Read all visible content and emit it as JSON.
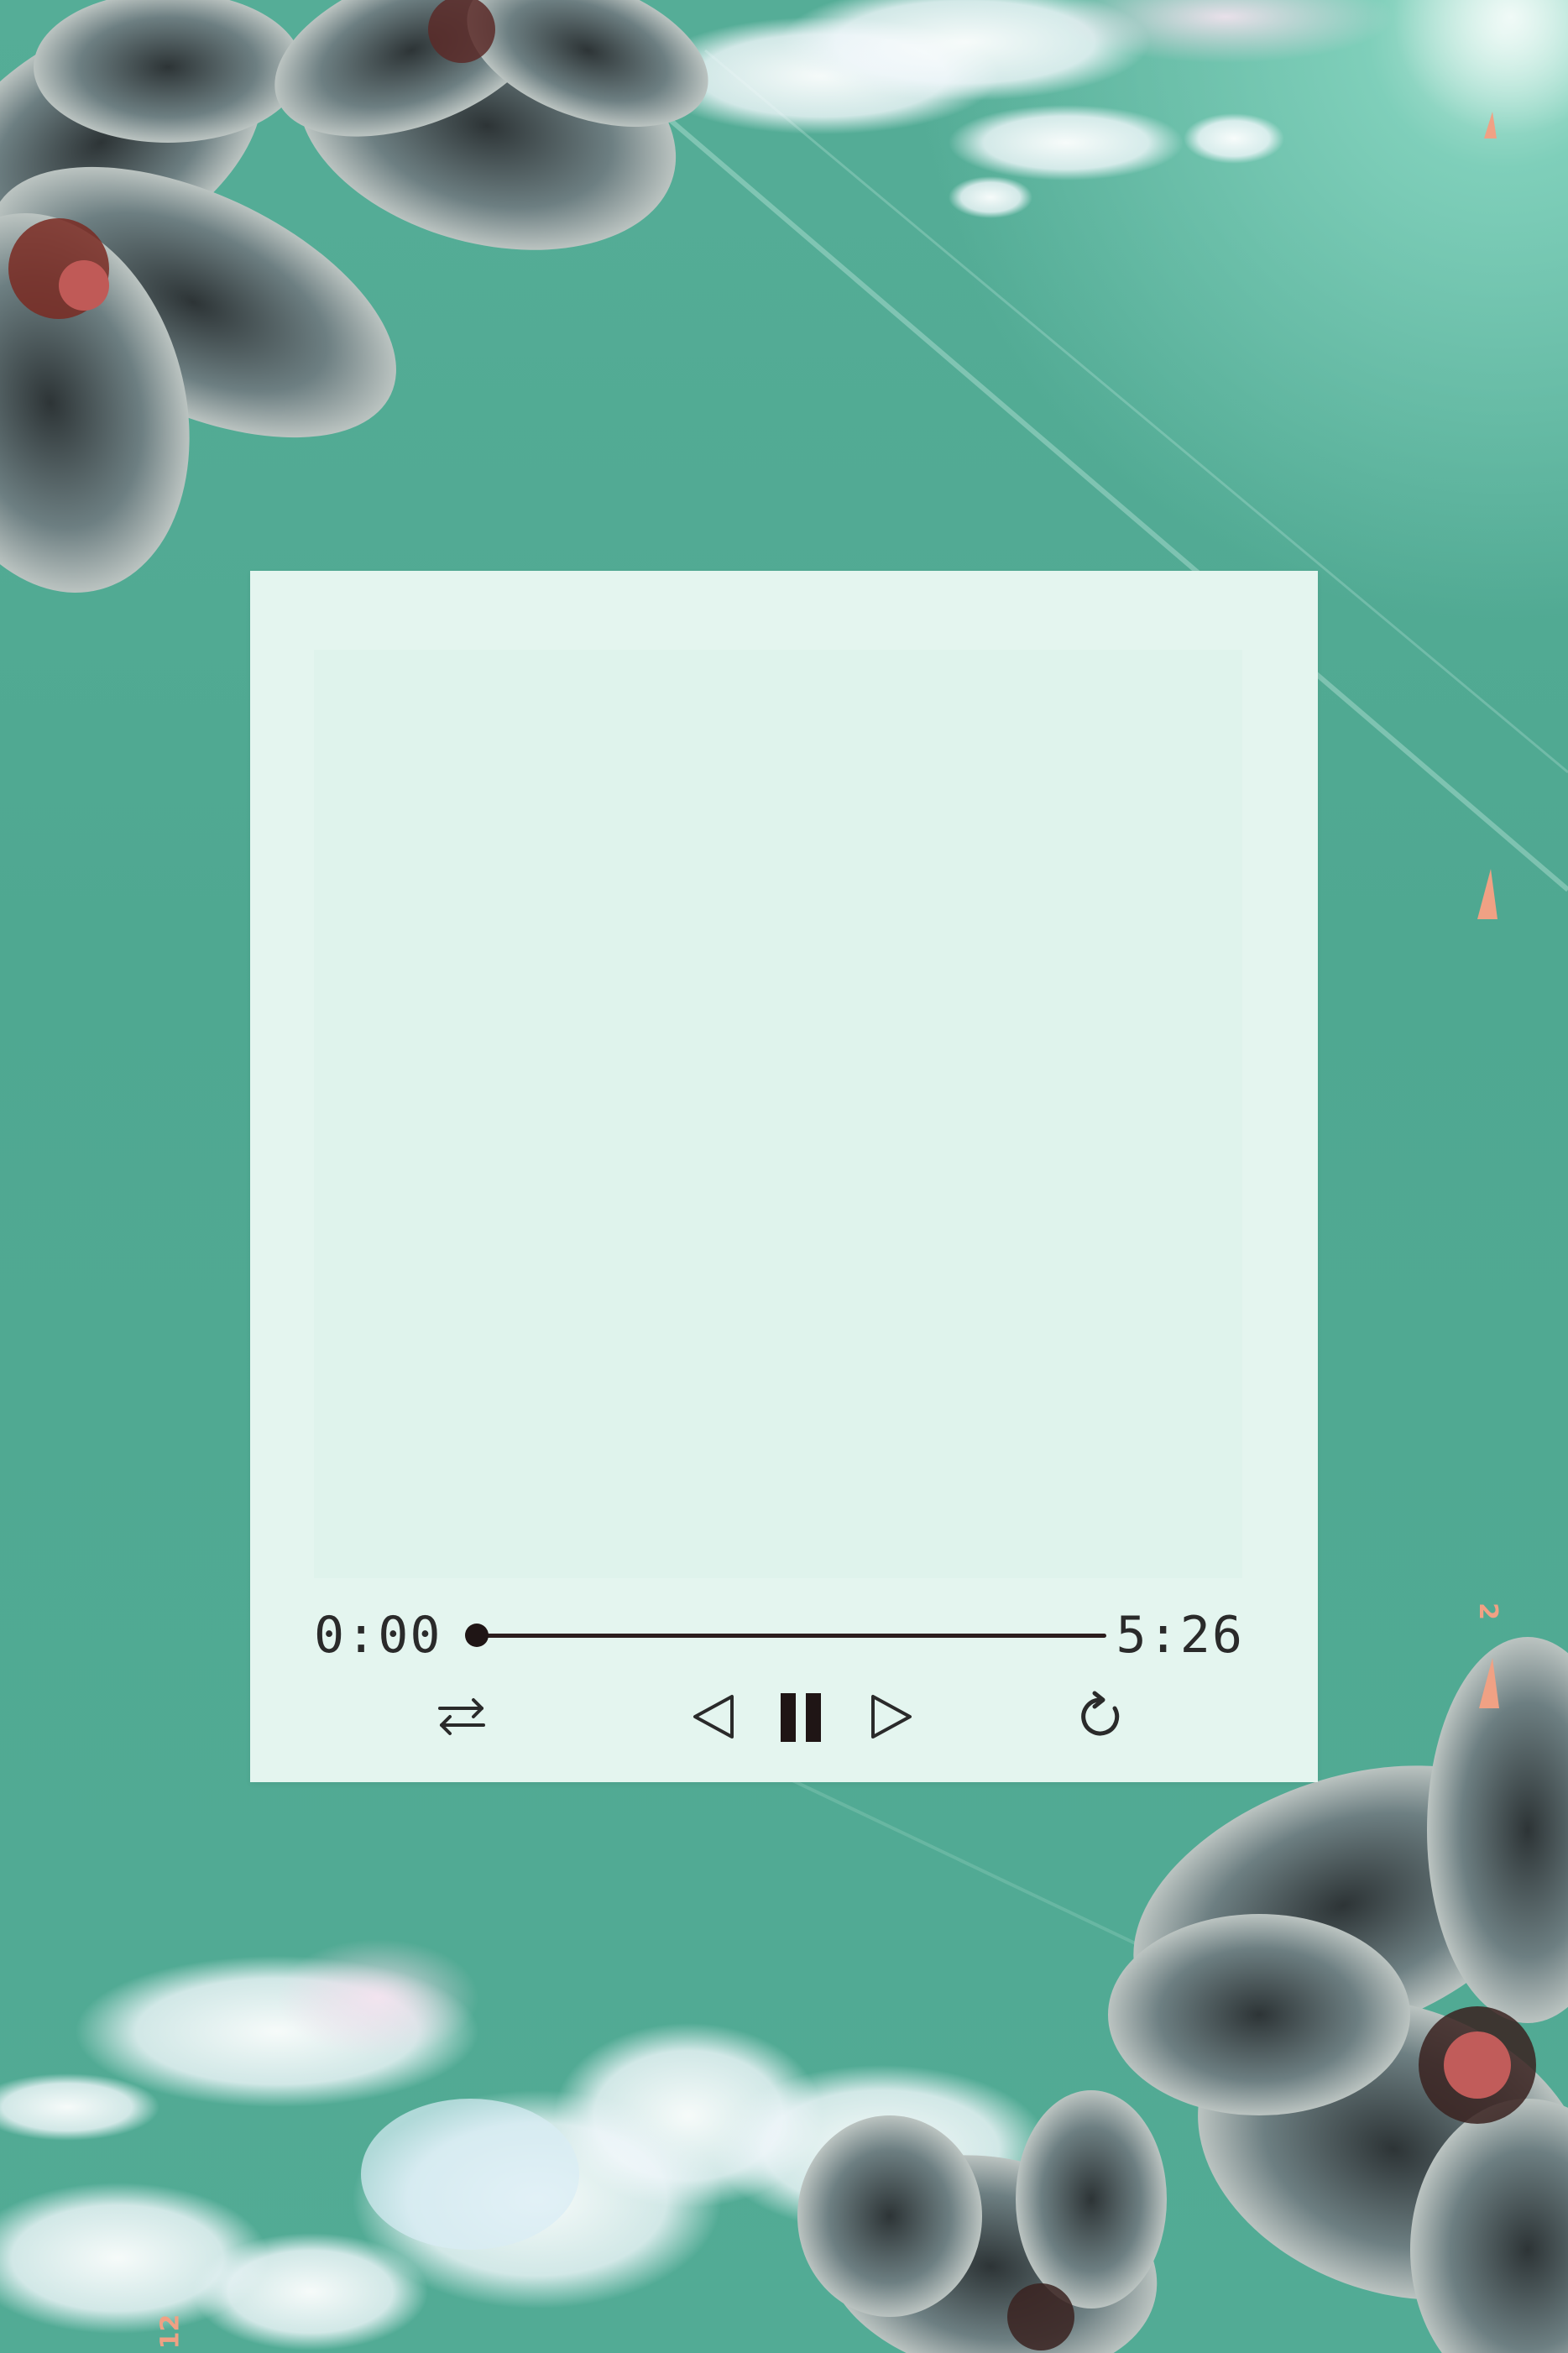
{
  "player": {
    "current_time": "0:00",
    "total_time": "5:26",
    "progress": 0.0,
    "controls": {
      "shuffle": "shuffle-icon",
      "previous": "previous-icon",
      "pause": "pause-icon",
      "next": "next-icon",
      "repeat": "repeat-icon"
    }
  },
  "film_marks": {
    "right": "2",
    "left": "12"
  },
  "colors": {
    "background": "#52ab95",
    "card": "#e4f5ef",
    "cover": "#dff3ec",
    "controls": "#1f1515",
    "film_mark": "#f0a184"
  }
}
